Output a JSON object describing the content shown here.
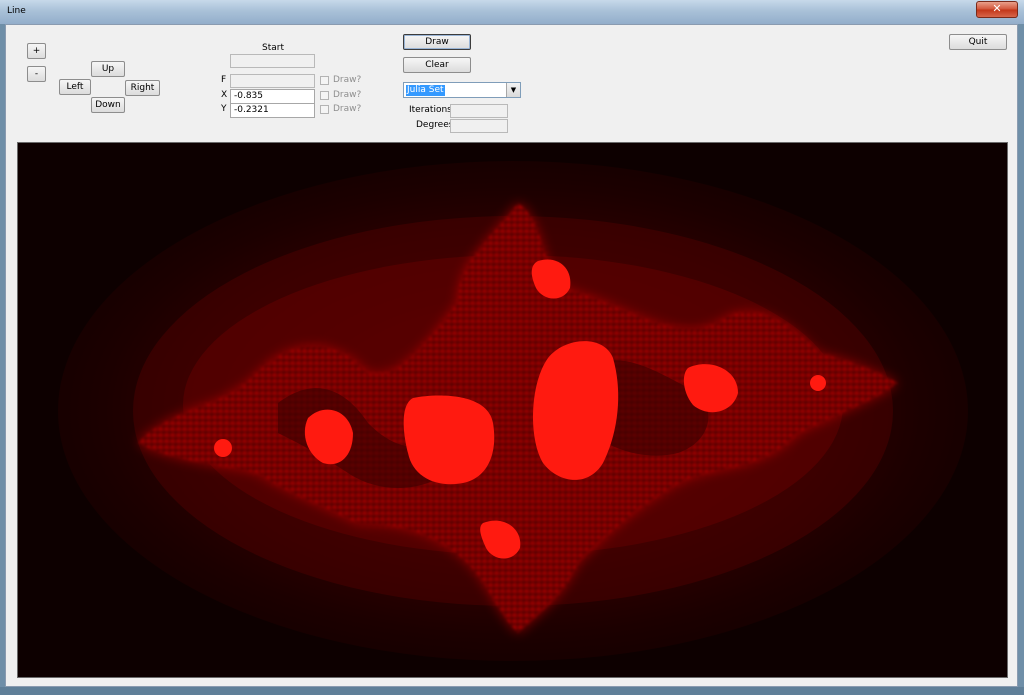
{
  "window": {
    "title": "Line",
    "close_glyph": "✕"
  },
  "nav": {
    "zoom_in": "+",
    "zoom_out": "-",
    "up": "Up",
    "left": "Left",
    "right": "Right",
    "down": "Down"
  },
  "params": {
    "start_label": "Start",
    "f_label": "F",
    "f_value": "",
    "f_draw": "Draw?",
    "x_label": "X",
    "x_value": "-0.835",
    "x_draw": "Draw?",
    "y_label": "Y",
    "y_value": "-0.2321",
    "y_draw": "Draw?"
  },
  "actions": {
    "draw": "Draw",
    "clear": "Clear",
    "quit": "Quit"
  },
  "fractal": {
    "selected": "Julia Set"
  },
  "stats": {
    "iterations_label": "Iterations",
    "iterations_value": "",
    "degrees_label": "Degrees",
    "degrees_value": ""
  },
  "colors": {
    "fractal_core": "#ff1a10",
    "fractal_glow": "#d40000",
    "background": "#100000"
  }
}
